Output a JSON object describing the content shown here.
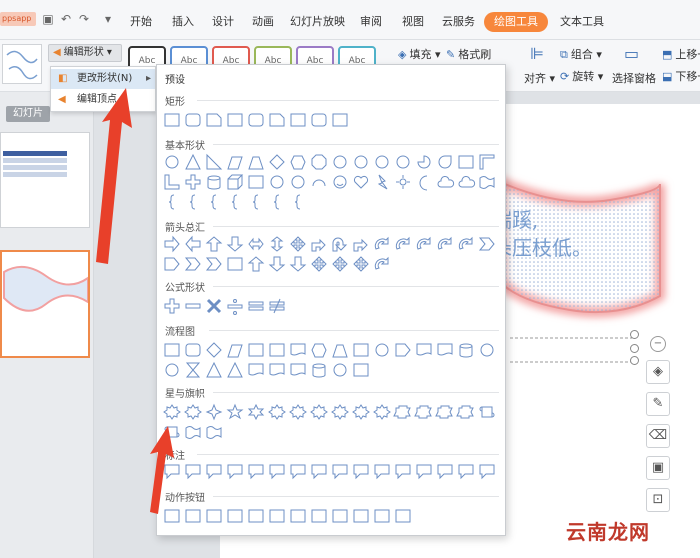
{
  "app": {
    "logo_text": "ppsapp"
  },
  "menu": {
    "items": [
      "开始",
      "插入",
      "设计",
      "动画",
      "幻灯片放映",
      "审阅",
      "视图",
      "云服务"
    ],
    "drawing_tools": "绘图工具",
    "text_tools": "文本工具"
  },
  "ribbon": {
    "edit_shape": "编辑形状",
    "style_sample": "Abc",
    "fill": "填充",
    "format_brush": "格式刷",
    "group": "组合",
    "rotate": "旋转",
    "align": "对齐",
    "selection_pane": "选择窗格",
    "move_up": "上移一",
    "move_down": "下移一"
  },
  "submenu": {
    "change_shape": "更改形状(N)",
    "edit_points": "编辑顶点"
  },
  "slides_panel": {
    "tab_label": "幻灯片"
  },
  "slide": {
    "line1": "端蹊,",
    "line2": "朵压枝低。"
  },
  "gallery": {
    "title": "预设",
    "categories": [
      "矩形",
      "基本形状",
      "箭头总汇",
      "公式形状",
      "流程图",
      "星与旗帜",
      "标注",
      "动作按钮"
    ]
  },
  "watermark": "云南龙网",
  "colors": {
    "accent": "#f7873c",
    "arrow_red": "#e8402a",
    "shape_stroke": "#6d8fc4"
  }
}
